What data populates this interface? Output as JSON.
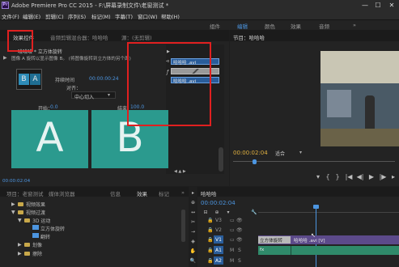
{
  "window": {
    "title": "Adobe Premiere Pro CC 2015 - F:\\屏幕录制文件\\老窗测试 *",
    "logo": "Pr",
    "minimize": "—",
    "maximize": "☐",
    "close": "✕"
  },
  "menu": [
    "文件(F)",
    "编辑(E)",
    "剪辑(C)",
    "序列(S)",
    "标记(M)",
    "字幕(T)",
    "窗口(W)",
    "帮助(H)"
  ],
  "workspaces": {
    "items": [
      "组件",
      "编辑",
      "颜色",
      "效果",
      "音频"
    ],
    "active": "编辑",
    "more": "»"
  },
  "effect_controls": {
    "tabs": [
      "效果控件",
      "音频剪辑混合器：哈哈哈",
      "源：(无剪辑)"
    ],
    "sequence_name": "哈哈哈 * 立方体旋转",
    "description": "图像 A 旋转以显示图像 B。 (将图像旋转到立方体的另个面)",
    "duration_label": "持续时间",
    "duration_value": "00:00:00:24",
    "alignment_label": "对齐：",
    "alignment_value": "中心切入",
    "start_label": "开始：",
    "start_value": "0.0",
    "end_label": "结束：",
    "end_value": "100.0",
    "preview_a": "A",
    "preview_b": "B",
    "mini_a": "B",
    "mini_b": "A",
    "timeline_clip_top": "哈哈哈 .avi",
    "timeline_clip_bottom": "哈哈哈 .avi",
    "timecode": "00:00:00:24",
    "footer_timecode": "00:00:02:04",
    "colors": {
      "preview": "#2b9a8e",
      "mini": "#2e8cb8"
    }
  },
  "program_monitor": {
    "tab": "节目：哈哈哈",
    "timecode": "00:00:02:04",
    "fit": "适合",
    "playhead_position": 0.12
  },
  "project": {
    "tabs": [
      "项目：老窗测试",
      "媒体浏览器",
      "信息",
      "效果",
      "标记",
      "»"
    ],
    "tree": [
      "视频效果",
      "视频过渡",
      "3D 运动",
      "立方体旋转",
      "翻转",
      "划像",
      "擦除"
    ]
  },
  "timeline": {
    "tab": "哈哈哈",
    "timecode": "00:00:02:04",
    "tracks": [
      "V3",
      "V2",
      "V1",
      "A1",
      "A2"
    ],
    "clip_video": "哈哈哈 .avi [V]",
    "transition": "立方体旋转",
    "clip_audio": "",
    "audio_marks": [
      "M",
      "S"
    ],
    "track_lock": "🔒",
    "track_eye": "👁"
  },
  "left_tools": [
    "▸",
    "⊕",
    "↔",
    "✂",
    "→",
    "◈",
    "✎",
    "✋",
    "🔍"
  ]
}
